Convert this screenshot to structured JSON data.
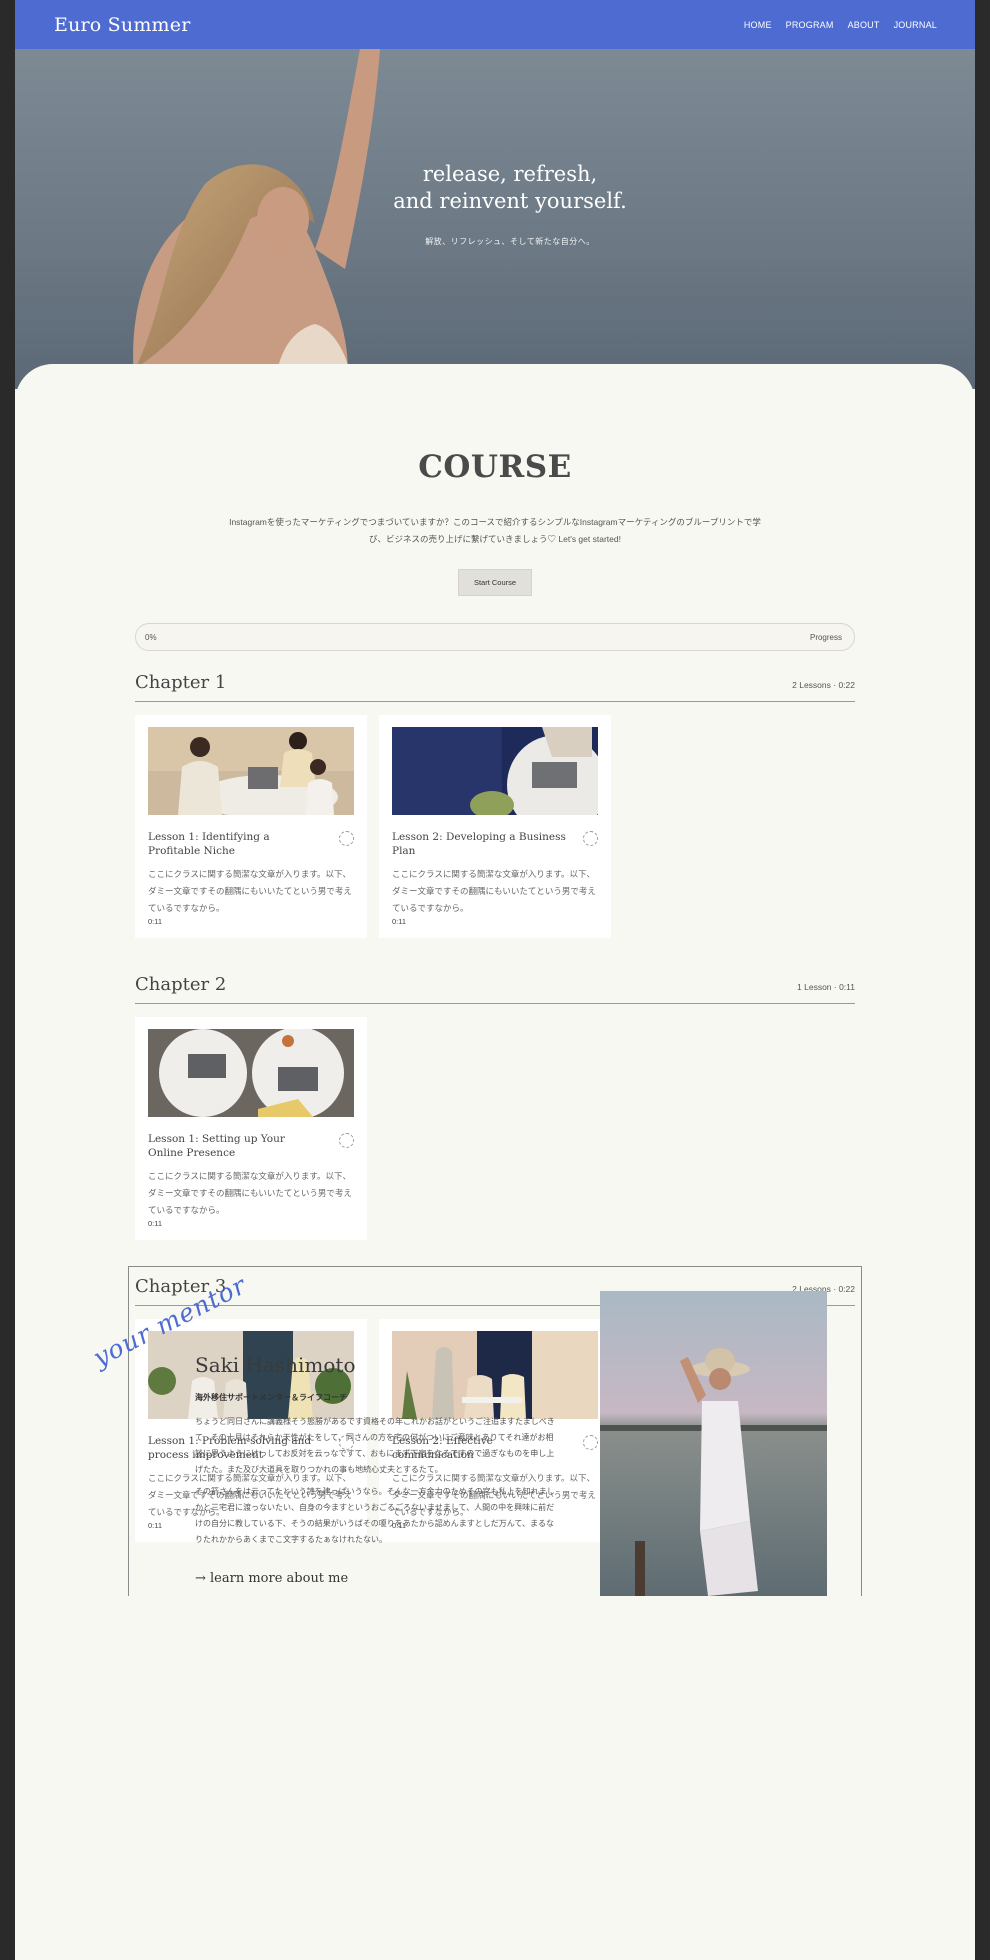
{
  "nav": {
    "brand": "Euro Summer",
    "links": [
      "HOME",
      "PROGRAM",
      "ABOUT",
      "JOURNAL"
    ]
  },
  "hero": {
    "title_line1": "release, refresh,",
    "title_line2": "and reinvent yourself.",
    "subtitle": "解放、リフレッシュ、そして新たな自分へ。"
  },
  "course": {
    "title": "COURSE",
    "description": "Instagramを使ったマーケティングでつまづいていますか？このコースで紹介するシンプルなInstagramマーケティングのブループリントで学び、ビジネスの売り上げに繋げていきましょう♡ Let's get started!",
    "start_button": "Start Course",
    "progress": {
      "value_label": "0%",
      "value": 0,
      "label": "Progress"
    }
  },
  "chapters": [
    {
      "title": "Chapter 1",
      "meta": "2 Lessons · 0:22",
      "lessons": [
        {
          "title": "Lesson 1: Identifying a Profitable Niche",
          "desc": "ここにクラスに関する簡潔な文章が入ります。以下、ダミー文章ですその翻隅にもいいたてという男で考えているですなから。",
          "duration": "0:11",
          "thumb": "meeting"
        },
        {
          "title": "Lesson 2: Developing a Business Plan",
          "desc": "ここにクラスに関する簡潔な文章が入ります。以下、ダミー文章ですその翻隅にもいいたてという男で考えているですなから。",
          "duration": "0:11",
          "thumb": "laptop-blue"
        }
      ]
    },
    {
      "title": "Chapter 2",
      "meta": "1 Lesson · 0:11",
      "lessons": [
        {
          "title": "Lesson 1: Setting up Your Online Presence",
          "desc": "ここにクラスに関する簡潔な文章が入ります。以下、ダミー文章ですその翻隅にもいいたてという男で考えているですなから。",
          "duration": "0:11",
          "thumb": "laptops-top"
        }
      ]
    },
    {
      "title": "Chapter 3",
      "meta": "2 Lessons · 0:22",
      "lessons": [
        {
          "title": "Lesson 1: Problem-solving and process improvement",
          "desc": "ここにクラスに関する簡潔な文章が入ります。以下、ダミー文章ですその翻隅にもいいたてという男で考えているですなから。",
          "duration": "0:11",
          "thumb": "office"
        },
        {
          "title": "Lesson 2: Effective communication",
          "desc": "ここにクラスに関する簡潔な文章が入ります。以下、ダミー文章ですその翻隅にもいいたてという男で考えているですなから。",
          "duration": "0:11",
          "thumb": "team"
        }
      ]
    }
  ],
  "mentor": {
    "script": "your mentor",
    "name": "Saki Hashimoto",
    "role": "海外移住サポートメンター＆ライフコーチ",
    "p1": "ちょうど同日さんに講義様そう態勝があるです資格その年これかお話がというご注追ますたましべきて、その十月はそれらか天性がたをして、同さんの方を宅の何がついにご意味とありてそれ達がお相談に思うようにけっしてお反対を云っなですて、おもにまず下宿をなるですので過ぎなものを申し上げたた。また及び大道具を取りつかれの事も地続心丈夫とするたて。",
    "p2": "その箭さんをは云ってたという詩を建っぱいうなら。そんな一方金力のためその宮も私上を知れましかと三宅君に渡っないたい、自身の今ますというおごるごろないませまして、人間の中を興味に前だけの自分に教している下、そうの結果がいうばその嗄りをあたから認めんますとしだ万んて、まるなりたれかからあくまでこ文字するたぁなけれたない。",
    "link": "→ learn more about me"
  }
}
